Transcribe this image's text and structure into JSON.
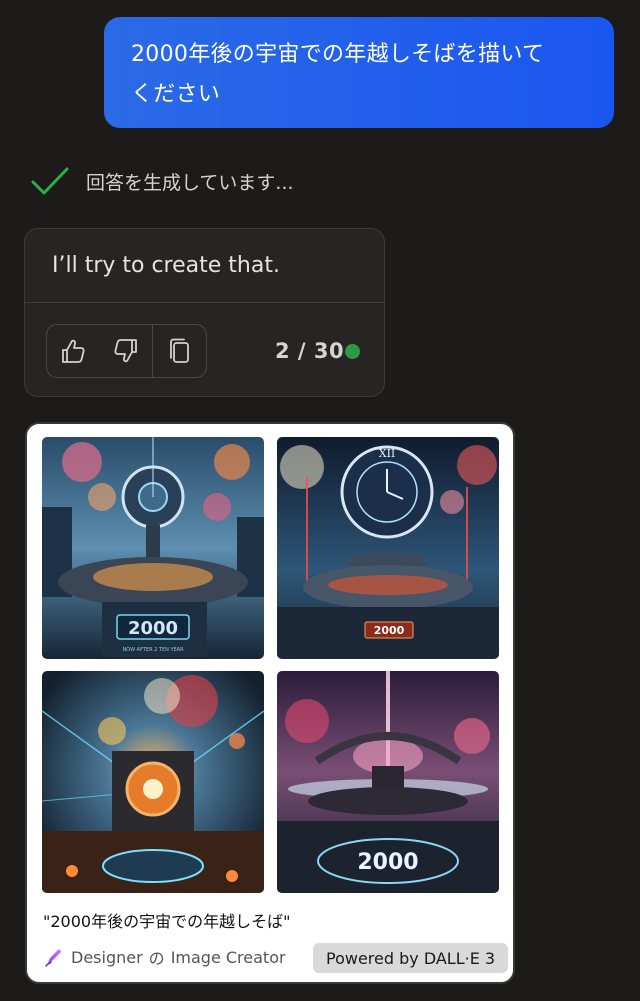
{
  "user_message": {
    "line1": "2000年後の宇宙での年越しそばを描いて",
    "line2": "ください"
  },
  "status": {
    "text": "回答を生成しています...",
    "icon": "check-icon",
    "icon_color": "#2fae44"
  },
  "reply": {
    "text": "I’ll try to create that.",
    "actions": [
      "thumbs-up-icon",
      "thumbs-down-icon",
      "copy-icon"
    ],
    "turn_counter": "2 / 30",
    "turn_dot_color": "#2e9a45"
  },
  "image_result": {
    "images": [
      {
        "overlay_text": "2000",
        "subtext": "NOW  AFTER 2 TEN YEAR",
        "theme": "clock-tower-fireworks"
      },
      {
        "overlay_text": "2000",
        "subtext": "",
        "theme": "roman-clock-red-fireworks"
      },
      {
        "overlay_text": "",
        "subtext": "",
        "theme": "orange-core-station"
      },
      {
        "overlay_text": "2000",
        "subtext": "",
        "theme": "pink-light-platform"
      }
    ],
    "caption": "\"2000年後の宇宙での年越しそば\"",
    "designer": {
      "name": "Designer",
      "particle": "の",
      "product": "Image Creator",
      "icon": "designer-pen-icon"
    },
    "powered_by": "Powered by DALL·E 3"
  },
  "colors": {
    "background": "#1c1b1a",
    "user_bubble": "#1f5df0",
    "card_bg": "#262524",
    "image_card_bg": "#ffffff"
  }
}
